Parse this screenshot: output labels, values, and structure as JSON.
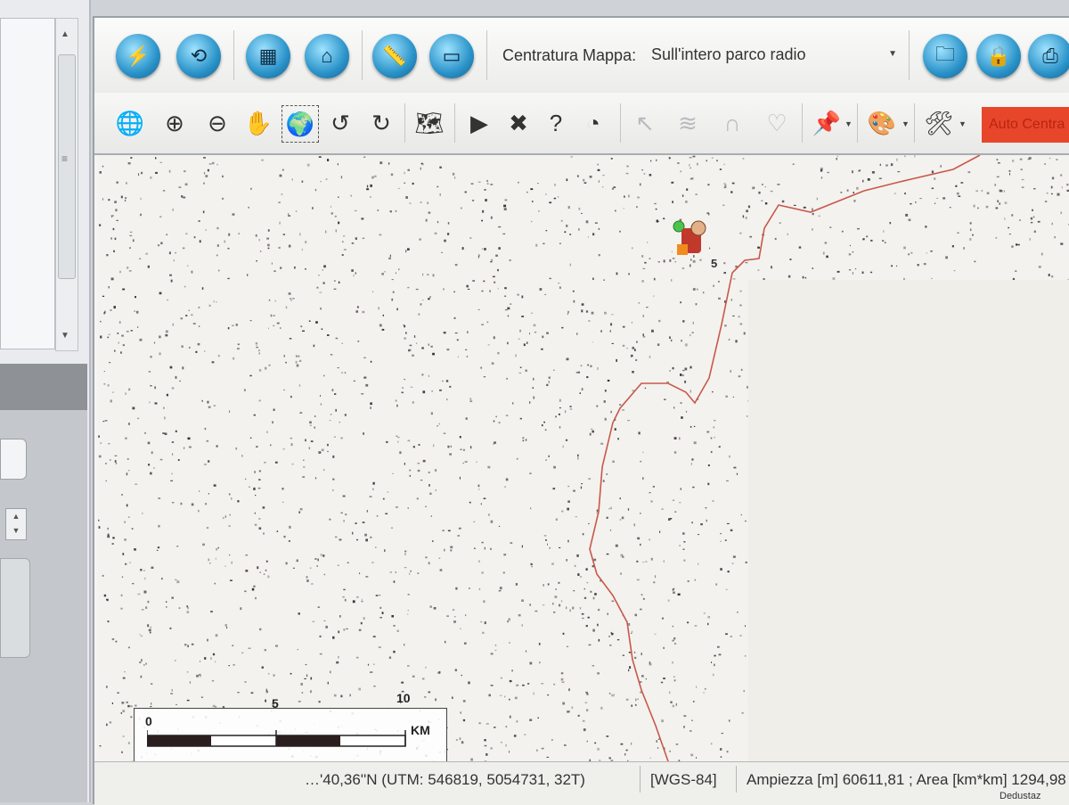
{
  "toolbar_top": {
    "buttons": [
      {
        "name": "connect-icon",
        "glyph": "⚡"
      },
      {
        "name": "sync-icon",
        "glyph": "⟲"
      },
      {
        "name": "map-grid-icon",
        "glyph": "▦"
      },
      {
        "name": "home-icon",
        "glyph": "⌂"
      },
      {
        "name": "ruler-icon",
        "glyph": "📏"
      },
      {
        "name": "eraser-icon",
        "glyph": "▭"
      },
      {
        "name": "folder-icon",
        "glyph": "🗀"
      },
      {
        "name": "lock-icon",
        "glyph": "🔒"
      },
      {
        "name": "printer-icon",
        "glyph": "⎙"
      }
    ],
    "centratura_label": "Centratura Mappa:",
    "centratura_value": "Sull'intero parco radio"
  },
  "toolbar_map": {
    "auto_center_label": "Auto Centra"
  },
  "map": {
    "marker_label": "5"
  },
  "scalebar": {
    "ticks": [
      "0",
      "5",
      "10"
    ],
    "unit": "KM"
  },
  "statusbar": {
    "coords": "…'40,36''N  (UTM: 546819, 5054731, 32T)",
    "datum": "[WGS-84]",
    "extent": "Ampiezza [m] 60611,81 ; Area [km*km] 1294,98",
    "corner": "Dedustaz"
  },
  "colors": {
    "toolbar_button": "#2a93c9",
    "auto_center": "#e8462b",
    "track": "#c9574a"
  }
}
